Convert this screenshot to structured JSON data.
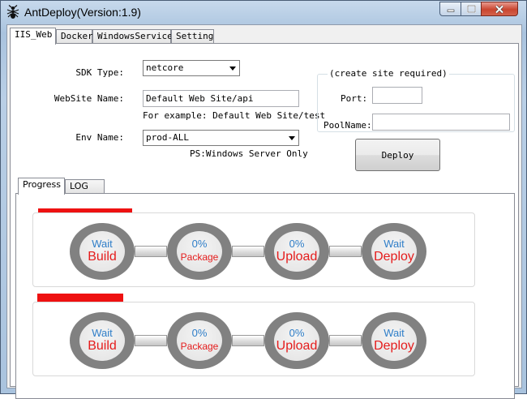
{
  "window": {
    "title": "AntDeploy(Version:1.9)"
  },
  "tabs": [
    {
      "label": "IIS_Web",
      "active": true
    },
    {
      "label": "Docker",
      "active": false
    },
    {
      "label": "WindowsService",
      "active": false
    },
    {
      "label": "Setting",
      "active": false
    }
  ],
  "form": {
    "sdk_label": "SDK Type:",
    "sdk_value": "netcore",
    "website_label": "WebSite Name:",
    "website_value": "Default Web Site/api",
    "website_hint": "For example: Default Web Site/test",
    "env_label": "Env Name:",
    "env_value": "prod-ALL",
    "env_hint": "PS:Windows Server Only"
  },
  "create_site": {
    "title": "(create site required)",
    "port_label": "Port:",
    "port_value": "",
    "pool_label": "PoolName:",
    "pool_value": ""
  },
  "deploy_button": "Deploy",
  "subtabs": [
    {
      "label": "Progress",
      "active": true
    },
    {
      "label": "LOG",
      "active": false
    }
  ],
  "pipelines": [
    {
      "steps": [
        {
          "top": "Wait",
          "bottom": "Build"
        },
        {
          "top": "0%",
          "bottom": "Package"
        },
        {
          "top": "0%",
          "bottom": "Upload"
        },
        {
          "top": "Wait",
          "bottom": "Deploy"
        }
      ]
    },
    {
      "steps": [
        {
          "top": "Wait",
          "bottom": "Build"
        },
        {
          "top": "0%",
          "bottom": "Package"
        },
        {
          "top": "0%",
          "bottom": "Upload"
        },
        {
          "top": "Wait",
          "bottom": "Deploy"
        }
      ]
    }
  ],
  "colors": {
    "progress_top": "#2f7ec8",
    "progress_bottom": "#e51c1c",
    "redacted_bar": "#ee1111",
    "close_button": "#c9452f"
  },
  "icons": {
    "app": "ant-icon",
    "minimize": "minimize-icon",
    "maximize": "maximize-icon",
    "close": "close-icon"
  }
}
